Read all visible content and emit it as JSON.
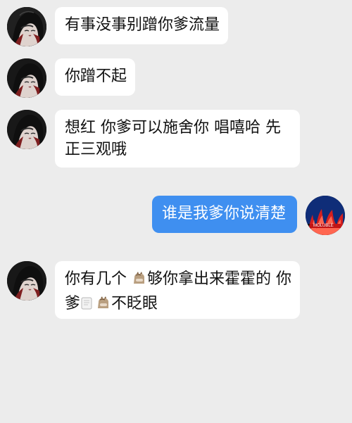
{
  "messages": [
    {
      "side": "left",
      "text": "有事没事别蹭你爹流量"
    },
    {
      "side": "left",
      "text": "你蹭不起"
    },
    {
      "side": "left",
      "line1": "想红 你爹可以施舍你 唱嘻哈 先",
      "line2": "正三观哦"
    },
    {
      "side": "right",
      "text": "谁是我爹你说清楚"
    },
    {
      "side": "left",
      "line1_prefix": "你有几个 ",
      "line1_suffix": "够你拿出来霍霍的 你",
      "line2_prefix": "爹",
      "line2_suffix": "不眨眼"
    }
  ],
  "icons": {
    "avatar_left": "anime-woman-avatar",
    "avatar_right": "flame-avatar",
    "horse_icon": "horse-icon",
    "paper_icon": "paper-icon"
  },
  "colors": {
    "background": "#ececec",
    "left_bubble": "#ffffff",
    "right_bubble": "#3f8ff0",
    "right_text": "#ffffff"
  }
}
